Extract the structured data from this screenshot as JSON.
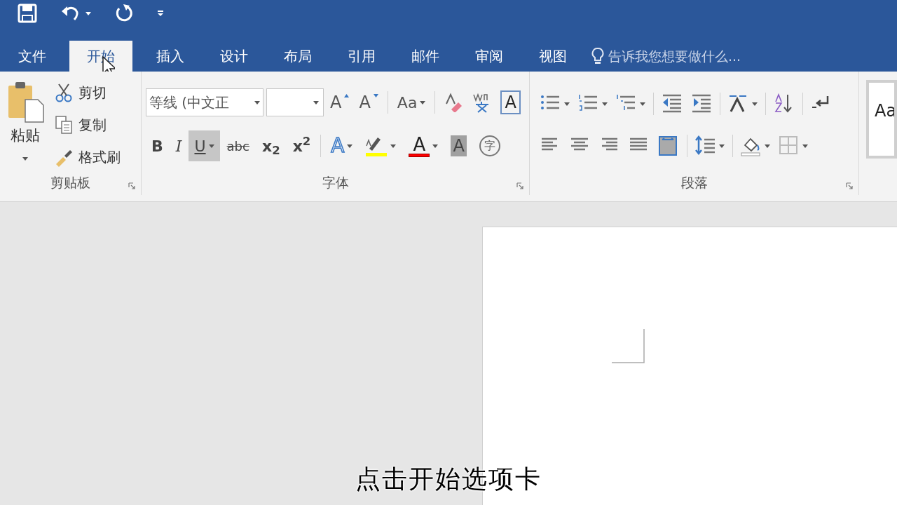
{
  "quick_access": [
    {
      "kind": "save"
    },
    {
      "kind": "undo"
    },
    {
      "kind": "caret"
    },
    {
      "kind": "redo"
    },
    {
      "kind": "customize"
    }
  ],
  "tabs": [
    {
      "label": "文件",
      "selected": false
    },
    {
      "label": "开始",
      "selected": true
    },
    {
      "label": "插入",
      "selected": false
    },
    {
      "label": "设计",
      "selected": false
    },
    {
      "label": "布局",
      "selected": false
    },
    {
      "label": "引用",
      "selected": false
    },
    {
      "label": "邮件",
      "selected": false
    },
    {
      "label": "审阅",
      "selected": false
    },
    {
      "label": "视图",
      "selected": false
    }
  ],
  "tell_me": {
    "placeholder": "告诉我您想要做什么..."
  },
  "clipboard": {
    "paste": "粘贴",
    "items": [
      {
        "kind": "cut",
        "label": "剪切"
      },
      {
        "kind": "copy",
        "label": "复制"
      },
      {
        "kind": "painter",
        "label": "格式刷"
      }
    ],
    "group_label": "剪贴板"
  },
  "font": {
    "font_name": "等线 (中文正",
    "row1": [
      {
        "kind": "grow",
        "label": "A"
      },
      {
        "kind": "shrink",
        "label": "A"
      },
      {
        "kind": "case",
        "label": "Aa"
      },
      {
        "kind": "clear"
      },
      {
        "kind": "pinyin"
      },
      {
        "kind": "border",
        "label": "A"
      }
    ],
    "row2": [
      {
        "kind": "bold",
        "label": "B",
        "pressed": false
      },
      {
        "kind": "italic",
        "label": "I",
        "pressed": false
      },
      {
        "kind": "underline",
        "label": "U",
        "pressed": true
      },
      {
        "kind": "strike",
        "label": "abc",
        "pressed": false
      },
      {
        "kind": "sub",
        "label": "x$_{2}$",
        "pressed": false
      },
      {
        "kind": "sup",
        "label": "x$^{2}$",
        "pressed": false
      },
      {
        "kind": "effects",
        "label": "A",
        "pressed": false
      },
      {
        "kind": "highlight",
        "pressed": false
      },
      {
        "kind": "color",
        "label": "A",
        "pressed": false
      },
      {
        "kind": "shading",
        "label": "A",
        "pressed": false
      },
      {
        "kind": "enclose",
        "label": "字",
        "pressed": false
      }
    ],
    "group_label": "字体"
  },
  "paragraph": {
    "row1": [
      {
        "kind": "bullets"
      },
      {
        "kind": "numbering"
      },
      {
        "kind": "multilevel"
      },
      {
        "kind": "outdent"
      },
      {
        "kind": "indent"
      },
      {
        "kind": "asian"
      },
      {
        "kind": "sort"
      },
      {
        "kind": "marks"
      }
    ],
    "row2": [
      {
        "kind": "left"
      },
      {
        "kind": "center"
      },
      {
        "kind": "right"
      },
      {
        "kind": "justify"
      },
      {
        "kind": "distributed"
      },
      {
        "kind": "spacing"
      },
      {
        "kind": "fill"
      },
      {
        "kind": "borders"
      }
    ],
    "group_label": "段落"
  },
  "styles": {
    "preview": "Aa"
  },
  "subtitle": "点击开始选项卡"
}
